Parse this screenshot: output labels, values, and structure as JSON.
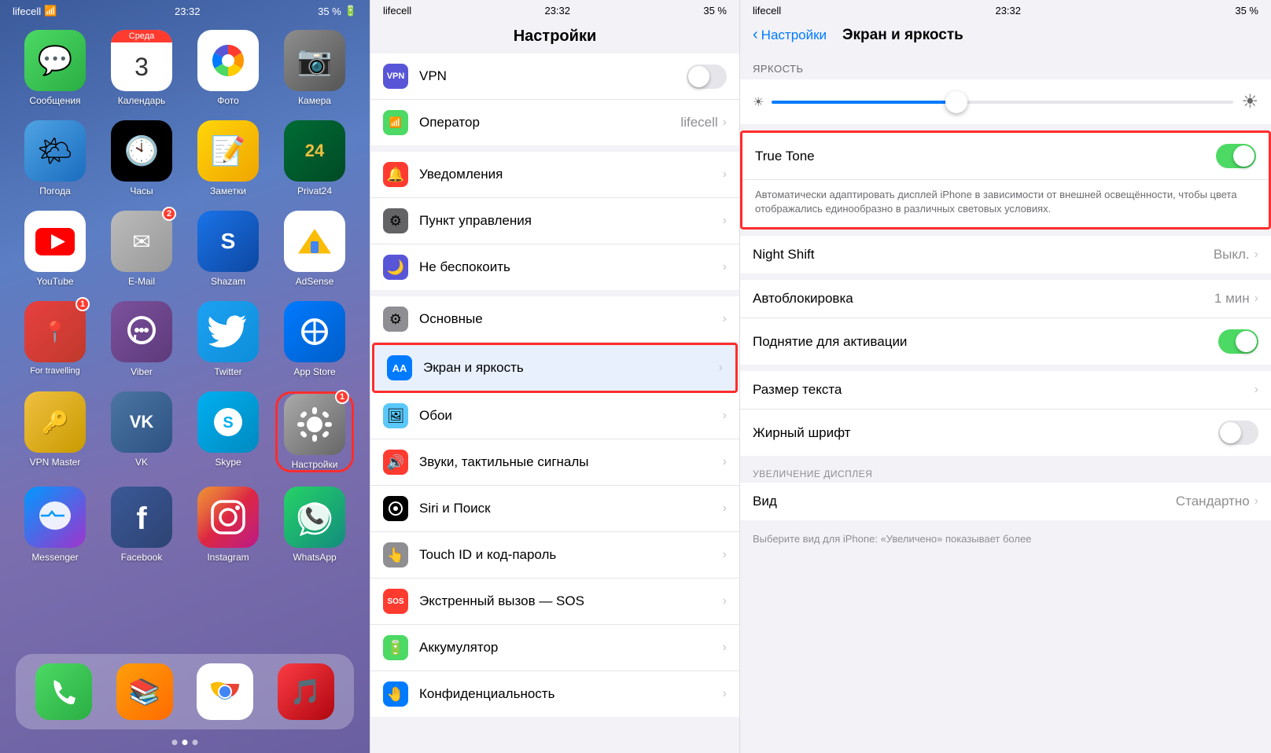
{
  "panel1": {
    "statusBar": {
      "carrier": "lifecell",
      "wifi": "📶",
      "time": "23:32",
      "battery": "35 %",
      "batteryIcon": "🔋"
    },
    "apps": [
      {
        "id": "messages",
        "label": "Сообщения",
        "icon": "💬",
        "iconClass": "ic-messages",
        "badge": null
      },
      {
        "id": "calendar",
        "label": "Календарь",
        "icon": "calendar",
        "iconClass": "ic-calendar",
        "badge": null,
        "calDay": "3",
        "calWeekday": "Среда"
      },
      {
        "id": "photos",
        "label": "Фото",
        "icon": "🌈",
        "iconClass": "ic-photos",
        "badge": null
      },
      {
        "id": "camera",
        "label": "Камера",
        "icon": "📷",
        "iconClass": "ic-camera",
        "badge": null
      },
      {
        "id": "weather",
        "label": "Погода",
        "icon": "🌤",
        "iconClass": "ic-weather",
        "badge": null
      },
      {
        "id": "clock",
        "label": "Часы",
        "icon": "🕙",
        "iconClass": "ic-clock",
        "badge": null
      },
      {
        "id": "notes",
        "label": "Заметки",
        "icon": "📝",
        "iconClass": "ic-notes",
        "badge": null
      },
      {
        "id": "privat24",
        "label": "Privat24",
        "icon": "24",
        "iconClass": "ic-privat24",
        "badge": null
      },
      {
        "id": "youtube",
        "label": "YouTube",
        "icon": "▶",
        "iconClass": "ic-youtube",
        "badge": null
      },
      {
        "id": "email",
        "label": "E-Mail",
        "icon": "✉",
        "iconClass": "ic-email",
        "badge": "2"
      },
      {
        "id": "shazam",
        "label": "Shazam",
        "icon": "S",
        "iconClass": "ic-shazam",
        "badge": null
      },
      {
        "id": "adsense",
        "label": "AdSense",
        "icon": "A",
        "iconClass": "ic-adsense",
        "badge": null
      },
      {
        "id": "fortravelling",
        "label": "For travelling",
        "icon": "📍",
        "iconClass": "ic-fortravelling",
        "badge": "1"
      },
      {
        "id": "viber",
        "label": "Viber",
        "icon": "📞",
        "iconClass": "ic-viber",
        "badge": null
      },
      {
        "id": "twitter",
        "label": "Twitter",
        "icon": "🐦",
        "iconClass": "ic-twitter",
        "badge": null
      },
      {
        "id": "appstore",
        "label": "App Store",
        "icon": "A",
        "iconClass": "ic-appstore",
        "badge": null
      },
      {
        "id": "vpnmaster",
        "label": "VPN Master",
        "icon": "🔑",
        "iconClass": "ic-vpnmaster",
        "badge": null
      },
      {
        "id": "vk",
        "label": "VK",
        "icon": "V",
        "iconClass": "ic-vk",
        "badge": null
      },
      {
        "id": "skype",
        "label": "Skype",
        "icon": "S",
        "iconClass": "ic-skype",
        "badge": null
      },
      {
        "id": "settings",
        "label": "Настройки",
        "icon": "⚙",
        "iconClass": "ic-settings",
        "badge": "1",
        "highlighted": true
      },
      {
        "id": "messenger",
        "label": "Messenger",
        "icon": "💬",
        "iconClass": "ic-messenger",
        "badge": null
      },
      {
        "id": "facebook",
        "label": "Facebook",
        "icon": "f",
        "iconClass": "ic-facebook",
        "badge": null
      },
      {
        "id": "instagram",
        "label": "Instagram",
        "icon": "📷",
        "iconClass": "ic-instagram",
        "badge": null
      },
      {
        "id": "whatsapp",
        "label": "WhatsApp",
        "icon": "💬",
        "iconClass": "ic-whatsapp",
        "badge": null
      }
    ],
    "dock": [
      {
        "id": "phone",
        "label": "",
        "icon": "📞",
        "iconClass": "ic-messages"
      },
      {
        "id": "books",
        "label": "",
        "icon": "📚",
        "iconClass": "ic-notes"
      },
      {
        "id": "chrome",
        "label": "",
        "icon": "🔵",
        "iconClass": "ic-email"
      },
      {
        "id": "music",
        "label": "",
        "icon": "🎵",
        "iconClass": "ic-notes"
      }
    ]
  },
  "panel2": {
    "statusBar": {
      "carrier": "lifecell",
      "time": "23:32",
      "battery": "35 %"
    },
    "title": "Настройки",
    "rows": [
      {
        "id": "vpn",
        "label": "VPN",
        "value": "",
        "icon": "VPN",
        "iconClass": "si-vpn"
      },
      {
        "id": "operator",
        "label": "Оператор",
        "value": "lifecell",
        "icon": "📶",
        "iconClass": "si-operator"
      },
      {
        "id": "notifications",
        "label": "Уведомления",
        "value": "",
        "icon": "🔔",
        "iconClass": "si-notifications"
      },
      {
        "id": "control",
        "label": "Пункт управления",
        "value": "",
        "icon": "⚙",
        "iconClass": "si-control"
      },
      {
        "id": "donotdisturb",
        "label": "Не беспокоить",
        "value": "",
        "icon": "🌙",
        "iconClass": "si-donotdisturb"
      },
      {
        "id": "general",
        "label": "Основные",
        "value": "",
        "icon": "⚙",
        "iconClass": "si-general"
      },
      {
        "id": "screen",
        "label": "Экран и яркость",
        "value": "",
        "icon": "AA",
        "iconClass": "si-screen",
        "highlighted": true
      },
      {
        "id": "wallpaper",
        "label": "Обои",
        "value": "",
        "icon": "🖼",
        "iconClass": "si-wallpaper"
      },
      {
        "id": "sounds",
        "label": "Звуки, тактильные сигналы",
        "value": "",
        "icon": "🔊",
        "iconClass": "si-sounds"
      },
      {
        "id": "siri",
        "label": "Siri и Поиск",
        "value": "",
        "icon": "🎙",
        "iconClass": "si-siri"
      },
      {
        "id": "touchid",
        "label": "Touch ID и код-пароль",
        "value": "",
        "icon": "👆",
        "iconClass": "si-touchid"
      },
      {
        "id": "sos",
        "label": "Экстренный вызов — SOS",
        "value": "",
        "icon": "SOS",
        "iconClass": "si-sos"
      },
      {
        "id": "battery",
        "label": "Аккумулятор",
        "value": "",
        "icon": "🔋",
        "iconClass": "si-battery"
      },
      {
        "id": "privacy",
        "label": "Конфиденциальность",
        "value": "",
        "icon": "🤚",
        "iconClass": "si-privacy"
      }
    ]
  },
  "panel3": {
    "statusBar": {
      "carrier": "lifecell",
      "time": "23:32",
      "battery": "35 %"
    },
    "backLabel": "Настройки",
    "title": "Экран и яркость",
    "brightnessLabel": "ЯРКОСТЬ",
    "sliderValue": 40,
    "trueTone": {
      "label": "True Tone",
      "enabled": true,
      "description": "Автоматически адаптировать дисплей iPhone в зависимости от внешней освещённости, чтобы цвета отображались единообразно в различных световых условиях."
    },
    "nightShift": {
      "label": "Night Shift",
      "value": "Выкл."
    },
    "autolockLabel": "Автоблокировка",
    "autolockValue": "1 мин",
    "raiseLabel": "Поднятие для активации",
    "raiseEnabled": true,
    "textSizeLabel": "Размер текста",
    "boldLabel": "Жирный шрифт",
    "boldEnabled": false,
    "displayZoomLabel": "УВЕЛИЧЕНИЕ ДИСПЛЕЯ",
    "viewLabel": "Вид",
    "viewValue": "Стандартно",
    "viewDescription": "Выберите вид для iPhone: «Увеличено» показывает более"
  }
}
